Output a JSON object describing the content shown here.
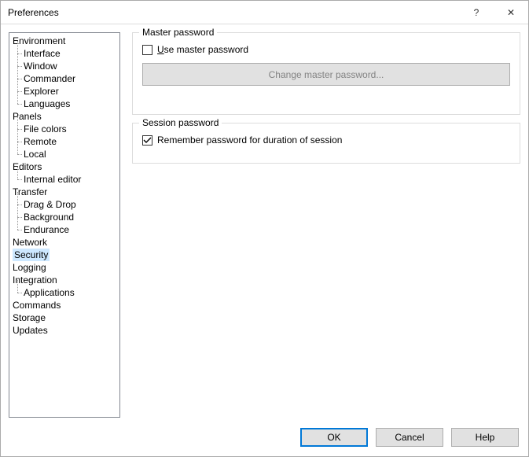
{
  "window": {
    "title": "Preferences",
    "help": "?",
    "close": "✕"
  },
  "tree": {
    "environment": "Environment",
    "interface": "Interface",
    "window": "Window",
    "commander": "Commander",
    "explorer": "Explorer",
    "languages": "Languages",
    "panels": "Panels",
    "file_colors": "File colors",
    "remote": "Remote",
    "local": "Local",
    "editors": "Editors",
    "internal_editor": "Internal editor",
    "transfer": "Transfer",
    "drag_drop": "Drag & Drop",
    "background": "Background",
    "endurance": "Endurance",
    "network": "Network",
    "security": "Security",
    "logging": "Logging",
    "integration": "Integration",
    "applications": "Applications",
    "commands": "Commands",
    "storage": "Storage",
    "updates": "Updates"
  },
  "master_password": {
    "legend": "Master password",
    "use_prefix": "U",
    "use_rest": "se master password",
    "change": "Change master password..."
  },
  "session_password": {
    "legend": "Session password",
    "remember": "Remember password for duration of session"
  },
  "buttons": {
    "ok": "OK",
    "cancel": "Cancel",
    "help": "Help"
  }
}
